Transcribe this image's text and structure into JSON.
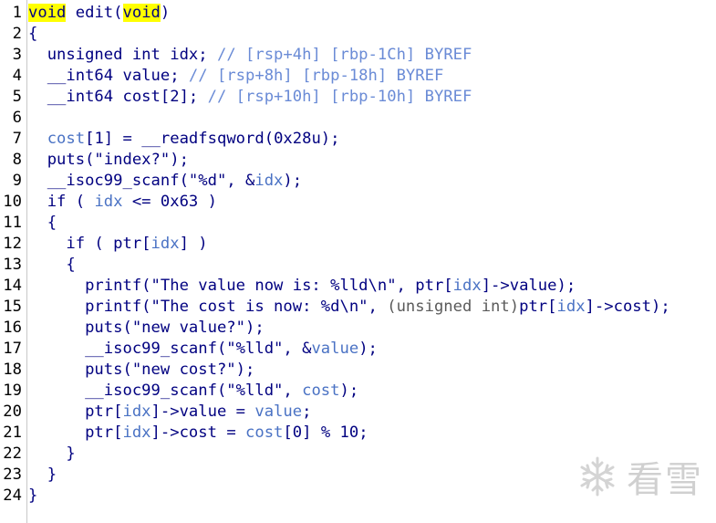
{
  "editor": {
    "lines": [
      {
        "n": "1",
        "segs": [
          {
            "t": "void",
            "c": "kw-hl"
          },
          {
            "t": " edit(",
            "c": ""
          },
          {
            "t": "void",
            "c": "kw-hl"
          },
          {
            "t": ")",
            "c": ""
          }
        ]
      },
      {
        "n": "2",
        "segs": [
          {
            "t": "{",
            "c": ""
          }
        ]
      },
      {
        "n": "3",
        "segs": [
          {
            "t": "  unsigned int idx; ",
            "c": ""
          },
          {
            "t": "// [rsp+4h] [rbp-1Ch] BYREF",
            "c": "c-com"
          }
        ]
      },
      {
        "n": "4",
        "segs": [
          {
            "t": "  __int64 value; ",
            "c": ""
          },
          {
            "t": "// [rsp+8h] [rbp-18h] BYREF",
            "c": "c-com"
          }
        ]
      },
      {
        "n": "5",
        "segs": [
          {
            "t": "  __int64 cost[2]; ",
            "c": ""
          },
          {
            "t": "// [rsp+10h] [rbp-10h] BYREF",
            "c": "c-com"
          }
        ]
      },
      {
        "n": "6",
        "segs": [
          {
            "t": "",
            "c": ""
          }
        ]
      },
      {
        "n": "7",
        "segs": [
          {
            "t": "  ",
            "c": ""
          },
          {
            "t": "cost",
            "c": "c-loc"
          },
          {
            "t": "[1] = __readfsqword(0x28u);",
            "c": ""
          }
        ]
      },
      {
        "n": "8",
        "segs": [
          {
            "t": "  puts(\"index?\");",
            "c": ""
          }
        ]
      },
      {
        "n": "9",
        "segs": [
          {
            "t": "  __isoc99_scanf(\"%d\", &",
            "c": ""
          },
          {
            "t": "idx",
            "c": "c-loc"
          },
          {
            "t": ");",
            "c": ""
          }
        ]
      },
      {
        "n": "10",
        "segs": [
          {
            "t": "  if ( ",
            "c": ""
          },
          {
            "t": "idx",
            "c": "c-loc"
          },
          {
            "t": " <= 0x63 )",
            "c": ""
          }
        ]
      },
      {
        "n": "11",
        "segs": [
          {
            "t": "  {",
            "c": ""
          }
        ]
      },
      {
        "n": "12",
        "segs": [
          {
            "t": "    if ( ptr[",
            "c": ""
          },
          {
            "t": "idx",
            "c": "c-loc"
          },
          {
            "t": "] )",
            "c": ""
          }
        ]
      },
      {
        "n": "13",
        "segs": [
          {
            "t": "    {",
            "c": ""
          }
        ]
      },
      {
        "n": "14",
        "segs": [
          {
            "t": "      printf(\"The value now is: %lld\\n\", ptr[",
            "c": ""
          },
          {
            "t": "idx",
            "c": "c-loc"
          },
          {
            "t": "]->value);",
            "c": ""
          }
        ]
      },
      {
        "n": "15",
        "segs": [
          {
            "t": "      printf(\"The cost is now: %d\\n\", ",
            "c": ""
          },
          {
            "t": "(unsigned int)",
            "c": "c-type"
          },
          {
            "t": "ptr[",
            "c": ""
          },
          {
            "t": "idx",
            "c": "c-loc"
          },
          {
            "t": "]->cost);",
            "c": ""
          }
        ]
      },
      {
        "n": "16",
        "segs": [
          {
            "t": "      puts(\"new value?\");",
            "c": ""
          }
        ]
      },
      {
        "n": "17",
        "segs": [
          {
            "t": "      __isoc99_scanf(\"%lld\", &",
            "c": ""
          },
          {
            "t": "value",
            "c": "c-loc"
          },
          {
            "t": ");",
            "c": ""
          }
        ]
      },
      {
        "n": "18",
        "segs": [
          {
            "t": "      puts(\"new cost?\");",
            "c": ""
          }
        ]
      },
      {
        "n": "19",
        "segs": [
          {
            "t": "      __isoc99_scanf(\"%lld\", ",
            "c": ""
          },
          {
            "t": "cost",
            "c": "c-loc"
          },
          {
            "t": ");",
            "c": ""
          }
        ]
      },
      {
        "n": "20",
        "segs": [
          {
            "t": "      ptr[",
            "c": ""
          },
          {
            "t": "idx",
            "c": "c-loc"
          },
          {
            "t": "]->value = ",
            "c": ""
          },
          {
            "t": "value",
            "c": "c-loc"
          },
          {
            "t": ";",
            "c": ""
          }
        ]
      },
      {
        "n": "21",
        "segs": [
          {
            "t": "      ptr[",
            "c": ""
          },
          {
            "t": "idx",
            "c": "c-loc"
          },
          {
            "t": "]->cost = ",
            "c": ""
          },
          {
            "t": "cost",
            "c": "c-loc"
          },
          {
            "t": "[0] % 10;",
            "c": ""
          }
        ]
      },
      {
        "n": "22",
        "segs": [
          {
            "t": "    }",
            "c": ""
          }
        ]
      },
      {
        "n": "23",
        "segs": [
          {
            "t": "  }",
            "c": ""
          }
        ]
      },
      {
        "n": "24",
        "segs": [
          {
            "t": "}",
            "c": ""
          }
        ]
      }
    ]
  },
  "watermark": {
    "text": "看雪",
    "icon": "snowflake-icon"
  },
  "colors": {
    "background": "#ffffff",
    "code": "#000080",
    "keyword_highlight": "#ffff00",
    "comment": "#6a8bd6",
    "local_var": "#4a72c4"
  }
}
